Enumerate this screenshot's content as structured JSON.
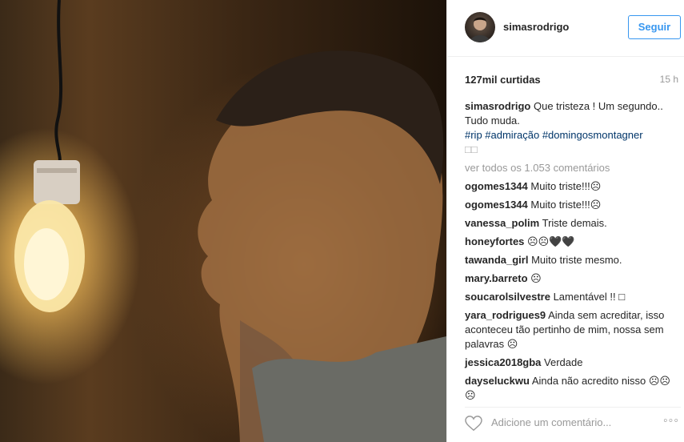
{
  "post": {
    "username": "simasrodrigo",
    "follow_label": "Seguir",
    "likes": "127mil curtidas",
    "time": "15 h",
    "caption": {
      "username": "simasrodrigo",
      "text": "Que tristeza ! Um segundo.. Tudo muda.",
      "hashtags": "#rip #admiração #domingosmontagner",
      "tail": "□□"
    },
    "view_all": "ver todos os 1.053 comentários",
    "comments": [
      {
        "user": "ogomes1344",
        "text": "Muito triste!!!☹"
      },
      {
        "user": "ogomes1344",
        "text": "Muito triste!!!☹"
      },
      {
        "user": "vanessa_polim",
        "text": "Triste demais."
      },
      {
        "user": "honeyfortes",
        "text": "☹☹🖤🖤"
      },
      {
        "user": "tawanda_girl",
        "text": "Muito triste mesmo."
      },
      {
        "user": "mary.barreto",
        "text": "☹"
      },
      {
        "user": "soucarolsilvestre",
        "text": "Lamentável !! □"
      },
      {
        "user": "yara_rodrigues9",
        "text": "Ainda sem acreditar, isso aconteceu tão pertinho de mim, nossa sem palavras ☹"
      },
      {
        "user": "jessica2018gba",
        "text": "Verdade"
      },
      {
        "user": "dayseluckwu",
        "text": "Ainda não acredito nisso ☹☹☹"
      }
    ],
    "add_comment_placeholder": "Adicione um comentário...",
    "more_label": "◦◦◦"
  },
  "icons": {
    "heart": "heart-outline-icon",
    "more": "more-options-icon"
  },
  "colors": {
    "accent": "#3897f0",
    "hashtag": "#003569",
    "muted": "#999999"
  }
}
